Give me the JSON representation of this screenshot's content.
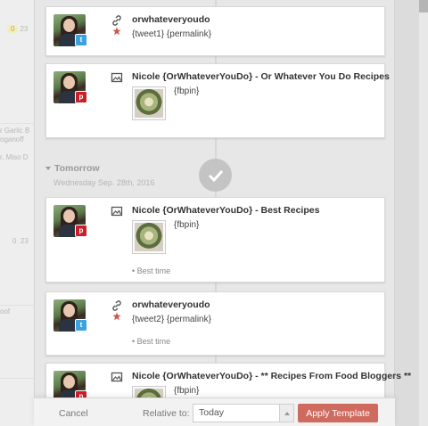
{
  "background": {
    "chips": [
      {
        "count": "0",
        "value": "23"
      },
      {
        "count": "0",
        "value": "23"
      }
    ],
    "snippets": [
      "r Garlic B",
      "oganoff",
      "r, Miso D",
      "oof"
    ]
  },
  "timeline": {
    "day_header": "Tomorrow",
    "day_subtitle": "Wednesday Sep. 28th, 2016"
  },
  "posts": [
    {
      "author": "orwhateveryoudo",
      "network": "twitter",
      "text": "{tweet1} {permalink}"
    },
    {
      "author": "Nicole {OrWhateverYouDo} - Or Whatever You Do Recipes",
      "network": "pinterest",
      "text": "{fbpin}"
    },
    {
      "author": "Nicole {OrWhateverYouDo} - Best Recipes",
      "network": "pinterest",
      "text": "{fbpin}",
      "note": "• Best time"
    },
    {
      "author": "orwhateveryoudo",
      "network": "twitter",
      "text": "{tweet2} {permalink}",
      "note": "• Best time"
    },
    {
      "author": "Nicole {OrWhateverYouDo} - ** Recipes From Food Bloggers **",
      "network": "pinterest",
      "text": "{fbpin}"
    }
  ],
  "footer": {
    "cancel_label": "Cancel",
    "relative_label": "Relative to:",
    "relative_value": "Today",
    "apply_label": "Apply Template"
  },
  "colors": {
    "apply": "#cf6a5f",
    "twitter": "#3aa3de",
    "pinterest": "#c8202b",
    "star": "#c8594d"
  }
}
